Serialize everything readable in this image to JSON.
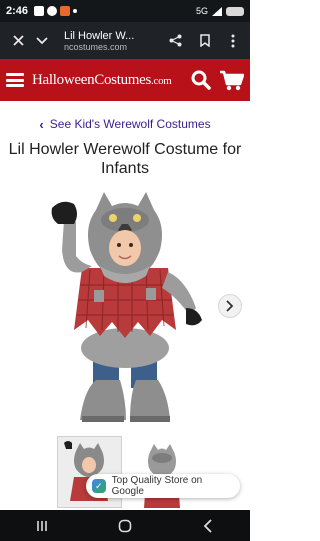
{
  "status_bar": {
    "time": "2:46",
    "network": "5G"
  },
  "browser": {
    "close_icon": "close-icon",
    "tabs_icon": "chevron-down-icon",
    "title": "Lil Howler W...",
    "url": "ncostumes.com",
    "share_icon": "share-icon",
    "bookmark_icon": "bookmark-icon",
    "menu_icon": "more-vert-icon"
  },
  "site": {
    "logo_main": "HalloweenCostumes",
    "logo_suffix": ".com",
    "accent_color": "#b8111a"
  },
  "breadcrumb": {
    "label": "See Kid's Werewolf Costumes"
  },
  "product": {
    "title": "Lil Howler Werewolf Costume for Infants"
  },
  "badge": {
    "label": "Top Quality Store on Google"
  }
}
